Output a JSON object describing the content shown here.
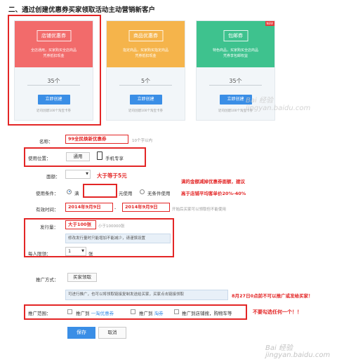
{
  "page_title": "二、通过创建优惠券买家领取活动主动营销新客户",
  "cards": [
    {
      "pill": "店铺优惠券",
      "desc": "全店通用，买家购买全店商品\n凭券抵扣现金",
      "count": "35个",
      "button": "立即创建",
      "foot": "近司创建100个淘宝卡券",
      "head_color": "#f26b6b"
    },
    {
      "pill": "商品优惠券",
      "desc": "指定商品，买家购买指定商品\n凭券抵扣现金",
      "count": "5个",
      "button": "立即创建",
      "foot": "近司创建100个淘宝卡券",
      "head_color": "#f5b44b"
    },
    {
      "pill": "包邮券",
      "desc": "特色商品，买家购买全店商品\n凭券享包邮权益",
      "count": "35个",
      "button": "立即创建",
      "foot": "近司创建100个淘宝卡券",
      "head_color": "#3ec28e",
      "badge": "NEW"
    }
  ],
  "form": {
    "name_label": "名称：",
    "name_value": "99全民焕新优惠券",
    "name_hint": "10个字以内",
    "position_label": "使用位置：",
    "position_general": "通用",
    "position_mobile": "手机专享",
    "denomination_label": "面额：",
    "denomination_note": "大于等于5元",
    "condition_label": "使用条件：",
    "condition_full": "满",
    "condition_unit": "元使用",
    "condition_none": "无条件使用",
    "condition_note_1": "满的金额减掉优惠券面额，建议",
    "condition_note_2": "高于店铺平均客单价20%-40%",
    "time_label": "有效时间：",
    "time_start": "2014年9月9日",
    "time_sep": "-",
    "time_end": "2014年9月9日",
    "time_hint": "开始后买家可以领取但不能使用",
    "issue_label": "发行量：",
    "issue_value": "大于100张",
    "issue_hint": "小于100000张",
    "issue_tip": "修改发行量时只能增加不能减少，请谨慎设置",
    "limit_label": "每人限领：",
    "limit_value": "1",
    "limit_unit": "张",
    "promo_label": "推广方式：",
    "promo_button": "买家领取",
    "promo_tip": "可进行推广，也可以将领取链接复制发送给买家，买家点击链接领取",
    "promo_note": "8月27日0点前不可以推广或发给买家！",
    "scope_label": "推广范围：",
    "scope_1_prefix": "推广到",
    "scope_1_link": "一淘优惠券",
    "scope_2_prefix": "推广到",
    "scope_2_link": "淘券",
    "scope_3": "推广到店铺搜，购物车等",
    "scope_note": "不要勾选任何一个！！",
    "save": "保存",
    "cancel": "取消"
  },
  "watermark": "Bai 经验\njingyan.baidu.com"
}
